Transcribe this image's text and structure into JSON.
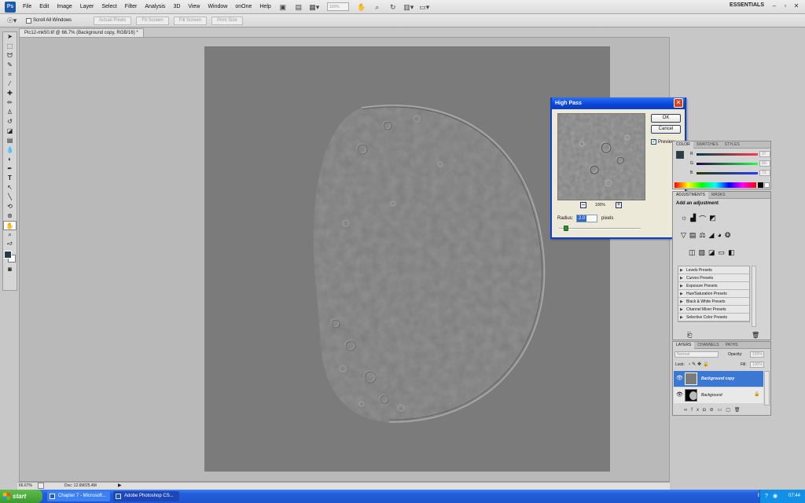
{
  "app": {
    "logo": "Ps",
    "workspace": "ESSENTIALS"
  },
  "menu": [
    "File",
    "Edit",
    "Image",
    "Layer",
    "Select",
    "Filter",
    "Analysis",
    "3D",
    "View",
    "Window",
    "onOne",
    "Help"
  ],
  "toolbar": {
    "zoom_placeholder": "100%"
  },
  "options_bar": {
    "scroll_all_windows": "Scroll All Windows",
    "buttons": [
      "Actual Pixels",
      "Fit Screen",
      "Fill Screen",
      "Print Size"
    ]
  },
  "document": {
    "tab_title": "Pic12-mk50.tif @ 66.7% (Background copy, RGB/16) *",
    "zoom": "66.67%",
    "doc_info": "Doc: 12.6M/25.4M"
  },
  "high_pass": {
    "title": "High Pass",
    "ok": "OK",
    "cancel": "Cancel",
    "preview_label": "Preview",
    "preview_checked": true,
    "preview_zoom": "100%",
    "radius_label": "Radius:",
    "radius_value": "2.0",
    "radius_unit": "pixels"
  },
  "color_panel": {
    "tabs": [
      "COLOR",
      "SWATCHES",
      "STYLES"
    ],
    "channels": [
      {
        "label": "R",
        "value": "37"
      },
      {
        "label": "G",
        "value": "60"
      },
      {
        "label": "B",
        "value": "73"
      }
    ]
  },
  "adjustments_panel": {
    "tabs": [
      "ADJUSTMENTS",
      "MASKS"
    ],
    "heading": "Add an adjustment",
    "presets": [
      "Levels Presets",
      "Curves Presets",
      "Exposure Presets",
      "Hue/Saturation Presets",
      "Black & White Presets",
      "Channel Mixer Presets",
      "Selective Color Presets"
    ]
  },
  "layers_panel": {
    "tabs": [
      "LAYERS",
      "CHANNELS",
      "PATHS"
    ],
    "blend_mode": "Normal",
    "opacity_label": "Opacity:",
    "opacity_value": "100%",
    "lock_label": "Lock:",
    "fill_label": "Fill:",
    "fill_value": "100%",
    "layers": [
      {
        "name": "Background copy",
        "selected": true
      },
      {
        "name": "Background",
        "selected": false
      }
    ]
  },
  "taskbar": {
    "start": "start",
    "tasks": [
      "Chapter 7 - Microsoft...",
      "Adobe Photoshop CS..."
    ],
    "language": "EN",
    "time": "07:44"
  },
  "colors": {
    "canvas": "#7b7b7b",
    "xp_title": "#0a45d6",
    "selected_layer": "#3a78d4",
    "foreground_swatch": "#253c49"
  }
}
